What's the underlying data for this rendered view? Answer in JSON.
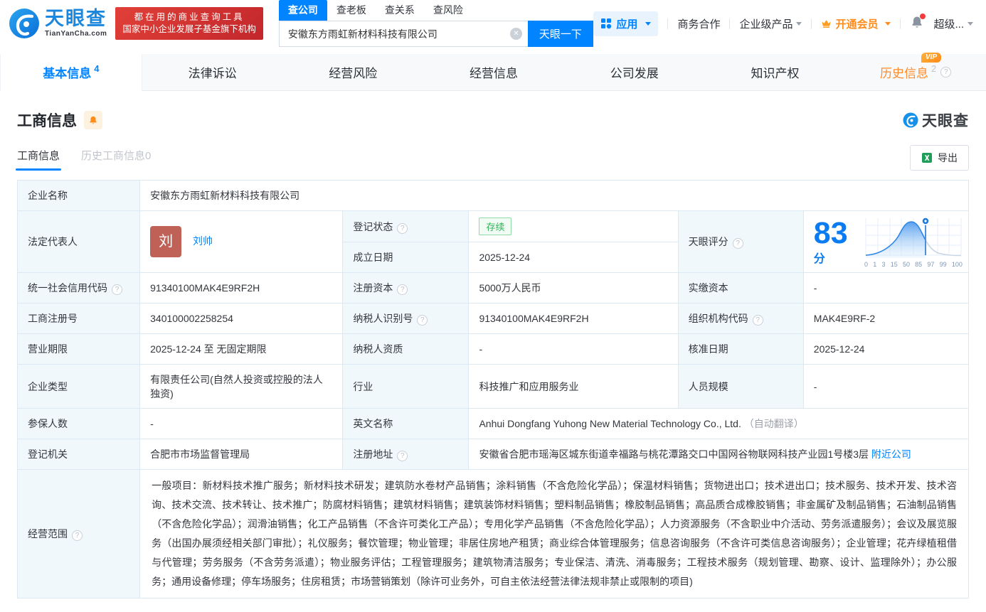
{
  "colors": {
    "primary_blue": "#0084ff",
    "orange": "#ff8b2a",
    "promo_red": "#d03530",
    "status_green": "#2fb35a",
    "avatar_red": "#bf6156"
  },
  "icons": {
    "help": "?",
    "clear": "✕",
    "logo": "tianyancha-swirl",
    "bell": "bell",
    "crown": "crown",
    "apps": "grid",
    "excel": "excel-sheet",
    "pin": "score-marker-pin"
  },
  "brand": {
    "logo_text": "天眼查",
    "logo_sub": "TianYanCha.com",
    "promo_line1": "都在用的商业查询工具",
    "promo_line2": "国家中小企业发展子基金旗下机构"
  },
  "search": {
    "tabs": [
      {
        "label": "查公司"
      },
      {
        "label": "查老板"
      },
      {
        "label": "查关系"
      },
      {
        "label": "查风险"
      }
    ],
    "value": "安徽东方雨虹新材料科技有限公司",
    "button": "天眼一下"
  },
  "topnav": {
    "apps": "应用",
    "business": "商务合作",
    "enterprise": "企业级产品",
    "vip": "开通会员",
    "super": "超级..."
  },
  "page_tabs": [
    {
      "label": "基本信息",
      "count": "4"
    },
    {
      "label": "法律诉讼"
    },
    {
      "label": "经营风险"
    },
    {
      "label": "经营信息"
    },
    {
      "label": "公司发展"
    },
    {
      "label": "知识产权"
    },
    {
      "label": "历史信息",
      "count": "2",
      "vip_badge": "VIP"
    }
  ],
  "section": {
    "title": "工商信息",
    "watermark": "天眼查",
    "subtabs": [
      {
        "label": "工商信息"
      },
      {
        "label": "历史工商信息0"
      }
    ],
    "export_label": "导出"
  },
  "score_chart": {
    "score": "83",
    "unit": "分",
    "ticks": [
      "0",
      "1",
      "3",
      "15",
      "50",
      "85",
      "97",
      "99",
      "100"
    ]
  },
  "fields": {
    "company_name": {
      "label": "企业名称",
      "value": "安徽东方雨虹新材料科技有限公司"
    },
    "legal_rep": {
      "label": "法定代表人",
      "avatar": "刘",
      "value": "刘帅"
    },
    "reg_status": {
      "label": "登记状态",
      "value": "存续"
    },
    "est_date": {
      "label": "成立日期",
      "value": "2025-12-24"
    },
    "score": {
      "label": "天眼评分"
    },
    "credit_code": {
      "label": "统一社会信用代码",
      "value": "91340100MAK4E9RF2H"
    },
    "reg_capital": {
      "label": "注册资本",
      "value": "5000万人民币"
    },
    "paid_capital": {
      "label": "实缴资本",
      "value": "-"
    },
    "reg_number": {
      "label": "工商注册号",
      "value": "340100002258254"
    },
    "taxpayer_id": {
      "label": "纳税人识别号",
      "value": "91340100MAK4E9RF2H"
    },
    "org_code": {
      "label": "组织机构代码",
      "value": "MAK4E9RF-2"
    },
    "business_term": {
      "label": "营业期限",
      "value": "2025-12-24 至 无固定期限"
    },
    "taxpayer_qualification": {
      "label": "纳税人资质",
      "value": "-"
    },
    "approval_date": {
      "label": "核准日期",
      "value": "2025-12-24"
    },
    "company_type": {
      "label": "企业类型",
      "value": "有限责任公司(自然人投资或控股的法人独资)"
    },
    "industry": {
      "label": "行业",
      "value": "科技推广和应用服务业"
    },
    "staff_size": {
      "label": "人员规模",
      "value": "-"
    },
    "insured_count": {
      "label": "参保人数",
      "value": "-"
    },
    "english_name": {
      "label": "英文名称",
      "value": "Anhui Dongfang Yuhong New Material Technology Co., Ltd.",
      "note": "（自动翻译）"
    },
    "registry": {
      "label": "登记机关",
      "value": "合肥市市场监督管理局"
    },
    "address": {
      "label": "注册地址",
      "value": "安徽省合肥市瑶海区城东街道幸福路与桃花潭路交口中国网谷物联网科技产业园1号楼3层",
      "link": "附近公司"
    },
    "business_scope": {
      "label": "经营范围",
      "value": "一般项目：新材料技术推广服务；新材料技术研发；建筑防水卷材产品销售；涂料销售（不含危险化学品）；保温材料销售；货物进出口；技术进出口；技术服务、技术开发、技术咨询、技术交流、技术转让、技术推广；防腐材料销售；建筑材料销售；建筑装饰材料销售；塑料制品销售；橡胶制品销售；高品质合成橡胶销售；非金属矿及制品销售；石油制品销售（不含危险化学品）；润滑油销售；化工产品销售（不含许可类化工产品）；专用化学产品销售（不含危险化学品）；人力资源服务（不含职业中介活动、劳务派遣服务）；会议及展览服务（出国办展须经相关部门审批）；礼仪服务；餐饮管理；物业管理；非居住房地产租赁；商业综合体管理服务；信息咨询服务（不含许可类信息咨询服务）；企业管理；花卉绿植租借与代管理；劳务服务（不含劳务派遣）；物业服务评估；工程管理服务；建筑物清洁服务；专业保洁、清洗、消毒服务；工程技术服务（规划管理、勘察、设计、监理除外）；办公服务；通用设备修理；停车场服务；住房租赁；市场营销策划（除许可业务外，可自主依法经营法律法规非禁止或限制的项目)"
    }
  }
}
